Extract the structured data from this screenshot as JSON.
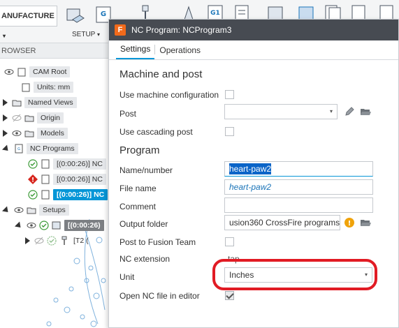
{
  "toolbar": {
    "workspace_label": "ANUFACTURE",
    "setup_label": "SETUP",
    "caret": "▾",
    "g_icon_text": "G",
    "g1_icon_text": "G1"
  },
  "browser": {
    "header": "ROWSER",
    "items": [
      {
        "label": "CAM Root"
      },
      {
        "label": "Units: mm"
      },
      {
        "label": "Named Views"
      },
      {
        "label": "Origin"
      },
      {
        "label": "Models"
      },
      {
        "label": "NC Programs"
      },
      {
        "label": "[(0:00:26)] NC"
      },
      {
        "label": "[(0:00:26)] NC"
      },
      {
        "label": "[(0:00:26)] NC"
      },
      {
        "label": "Setups"
      },
      {
        "label": "[(0:00:26)"
      },
      {
        "label": "[T2 ("
      }
    ]
  },
  "dialog": {
    "title": "NC Program: NCProgram3",
    "app_icon": "F",
    "tabs": [
      {
        "label": "Settings",
        "active": true
      },
      {
        "label": "Operations",
        "active": false
      }
    ],
    "machine_section": {
      "title": "Machine and post",
      "use_machine_config_label": "Use machine configuration",
      "post_label": "Post",
      "post_value": "",
      "use_cascading_post_label": "Use cascading post"
    },
    "program_section": {
      "title": "Program",
      "name_number_label": "Name/number",
      "name_number_value": "heart-paw2",
      "file_name_label": "File name",
      "file_name_value": "heart-paw2",
      "comment_label": "Comment",
      "comment_value": "",
      "output_folder_label": "Output folder",
      "output_folder_value": "usion360 CrossFire programs",
      "post_to_team_label": "Post to Fusion Team",
      "nc_extension_label": "NC extension",
      "nc_extension_value": "tap",
      "unit_label": "Unit",
      "unit_value": "Inches",
      "open_nc_label": "Open NC file in editor"
    },
    "dropdown_caret": "▾",
    "info_icon_text": "!"
  },
  "colors": {
    "accent": "#0696d7",
    "selection": "#0a64c8",
    "titlebar": "#474b52",
    "annotation_ring": "#e11b24",
    "info": "#f0a30a"
  }
}
